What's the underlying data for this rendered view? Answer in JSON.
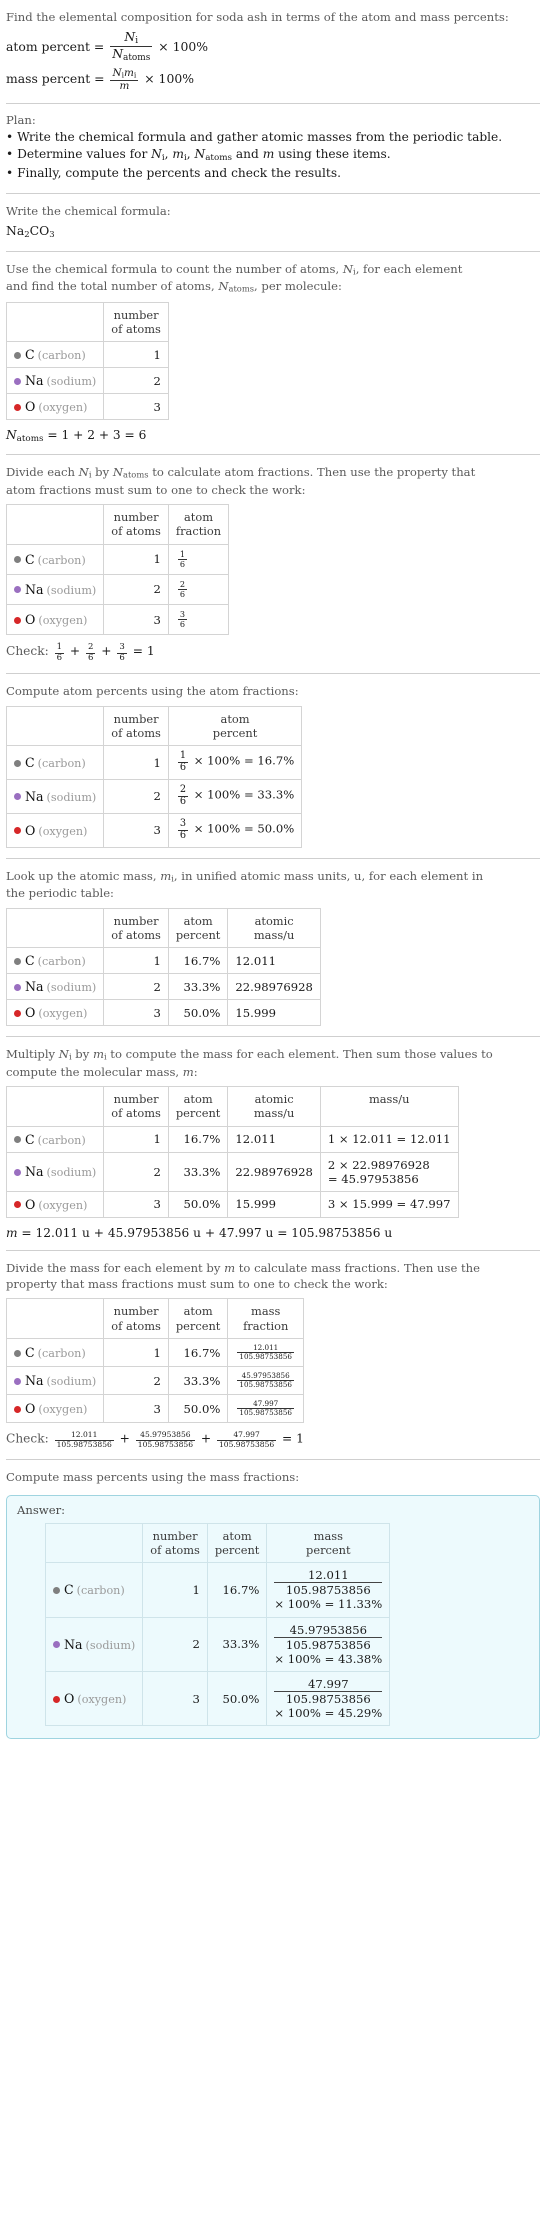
{
  "colors": {
    "carbon": "#7f7f7f",
    "sodium": "#9a6fc0",
    "oxygen": "#d62728",
    "answer_border": "#9fd4e0",
    "answer_bg": "#edfafd"
  },
  "intro": {
    "prompt": "Find the elemental composition for soda ash in terms of the atom and mass percents:",
    "atom_percent_label": "atom percent",
    "atom_percent_num": "N",
    "atom_percent_num_sub": "i",
    "atom_percent_den": "N",
    "atom_percent_den_sub": "atoms",
    "mass_percent_label": "mass percent",
    "mass_percent_num": "N",
    "mass_percent_num_sub": "i",
    "mass_percent_num2": "m",
    "mass_percent_num2_sub": "i",
    "mass_percent_den": "m",
    "times100": "× 100%"
  },
  "plan": {
    "title": "Plan:",
    "items": [
      "• Write the chemical formula and gather atomic masses from the periodic table.",
      "• Determine values for Ni, mi, Natoms and m using these items.",
      "• Finally, compute the percents and check the results."
    ]
  },
  "formula_section": {
    "prompt": "Write the chemical formula:",
    "formula_parts": [
      "Na",
      "2",
      "CO",
      "3"
    ],
    "formula_plain": "Na2CO3"
  },
  "count_section": {
    "prompt_line1": "Use the chemical formula to count the number of atoms, Ni, for each element",
    "prompt_line2": "and find the total number of atoms, Natoms, per molecule:",
    "headers": [
      "",
      "number of atoms"
    ],
    "rows": [
      {
        "symbol": "C",
        "name": "(carbon)",
        "color": "#7f7f7f",
        "count": "1"
      },
      {
        "symbol": "Na",
        "name": "(sodium)",
        "color": "#9a6fc0",
        "count": "2"
      },
      {
        "symbol": "O",
        "name": "(oxygen)",
        "color": "#d62728",
        "count": "3"
      }
    ],
    "total_line": "Natoms = 1 + 2 + 3 = 6",
    "total_value": "6"
  },
  "fraction_section": {
    "prompt_line1": "Divide each Ni by Natoms to calculate atom fractions. Then use the property that",
    "prompt_line2": "atom fractions must sum to one to check the work:",
    "headers": [
      "",
      "number of atoms",
      "atom fraction"
    ],
    "rows": [
      {
        "symbol": "C",
        "name": "(carbon)",
        "color": "#7f7f7f",
        "count": "1",
        "num": "1",
        "den": "6"
      },
      {
        "symbol": "Na",
        "name": "(sodium)",
        "color": "#9a6fc0",
        "count": "2",
        "num": "2",
        "den": "6"
      },
      {
        "symbol": "O",
        "name": "(oxygen)",
        "color": "#d62728",
        "count": "3",
        "num": "3",
        "den": "6"
      }
    ],
    "check_label": "Check:",
    "check_terms": [
      [
        "1",
        "6"
      ],
      [
        "2",
        "6"
      ],
      [
        "3",
        "6"
      ]
    ],
    "check_result": "1"
  },
  "atom_percent_section": {
    "prompt": "Compute atom percents using the atom fractions:",
    "headers": [
      "",
      "number of atoms",
      "atom percent"
    ],
    "rows": [
      {
        "symbol": "C",
        "name": "(carbon)",
        "color": "#7f7f7f",
        "count": "1",
        "num": "1",
        "den": "6",
        "result": "× 100% = 16.7%"
      },
      {
        "symbol": "Na",
        "name": "(sodium)",
        "color": "#9a6fc0",
        "count": "2",
        "num": "2",
        "den": "6",
        "result": "× 100% = 33.3%"
      },
      {
        "symbol": "O",
        "name": "(oxygen)",
        "color": "#d62728",
        "count": "3",
        "num": "3",
        "den": "6",
        "result": "× 100% = 50.0%"
      }
    ]
  },
  "atomic_mass_section": {
    "prompt_line1": "Look up the atomic mass, mi, in unified atomic mass units, u, for each element in",
    "prompt_line2": "the periodic table:",
    "headers": [
      "",
      "number of atoms",
      "atom percent",
      "atomic mass/u"
    ],
    "rows": [
      {
        "symbol": "C",
        "name": "(carbon)",
        "color": "#7f7f7f",
        "count": "1",
        "atom_percent": "16.7%",
        "mass": "12.011"
      },
      {
        "symbol": "Na",
        "name": "(sodium)",
        "color": "#9a6fc0",
        "count": "2",
        "atom_percent": "33.3%",
        "mass": "22.98976928"
      },
      {
        "symbol": "O",
        "name": "(oxygen)",
        "color": "#d62728",
        "count": "3",
        "atom_percent": "50.0%",
        "mass": "15.999"
      }
    ]
  },
  "mass_section": {
    "prompt_line1": "Multiply Ni by mi to compute the mass for each element. Then sum those values to",
    "prompt_line2": "compute the molecular mass, m:",
    "headers": [
      "",
      "number of atoms",
      "atom percent",
      "atomic mass/u",
      "mass/u"
    ],
    "rows": [
      {
        "symbol": "C",
        "name": "(carbon)",
        "color": "#7f7f7f",
        "count": "1",
        "atom_percent": "16.7%",
        "mass": "12.011",
        "product": "1 × 12.011 = 12.011",
        "product2": ""
      },
      {
        "symbol": "Na",
        "name": "(sodium)",
        "color": "#9a6fc0",
        "count": "2",
        "atom_percent": "33.3%",
        "mass": "22.98976928",
        "product": "2 × 22.98976928",
        "product2": "= 45.97953856"
      },
      {
        "symbol": "O",
        "name": "(oxygen)",
        "color": "#d62728",
        "count": "3",
        "atom_percent": "50.0%",
        "mass": "15.999",
        "product": "3 × 15.999 = 47.997",
        "product2": ""
      }
    ],
    "total_line": "m = 12.011 u + 45.97953856 u + 47.997 u = 105.98753856 u"
  },
  "mass_fraction_section": {
    "prompt_line1": "Divide the mass for each element by m to calculate mass fractions. Then use the",
    "prompt_line2": "property that mass fractions must sum to one to check the work:",
    "headers": [
      "",
      "number of atoms",
      "atom percent",
      "mass fraction"
    ],
    "denominator": "105.98753856",
    "rows": [
      {
        "symbol": "C",
        "name": "(carbon)",
        "color": "#7f7f7f",
        "count": "1",
        "atom_percent": "16.7%",
        "num": "12.011"
      },
      {
        "symbol": "Na",
        "name": "(sodium)",
        "color": "#9a6fc0",
        "count": "2",
        "atom_percent": "33.3%",
        "num": "45.97953856"
      },
      {
        "symbol": "O",
        "name": "(oxygen)",
        "color": "#d62728",
        "count": "3",
        "atom_percent": "50.0%",
        "num": "47.997"
      }
    ],
    "check_label": "Check:",
    "check_terms": [
      "12.011",
      "45.97953856",
      "47.997"
    ],
    "check_result": "1"
  },
  "mass_percent_section": {
    "prompt": "Compute mass percents using the mass fractions:",
    "answer_label": "Answer:",
    "headers": [
      "",
      "number of atoms",
      "atom percent",
      "mass percent"
    ],
    "denominator": "105.98753856",
    "rows": [
      {
        "symbol": "C",
        "name": "(carbon)",
        "color": "#7f7f7f",
        "count": "1",
        "atom_percent": "16.7%",
        "num": "12.011",
        "result": "× 100% = 11.33%"
      },
      {
        "symbol": "Na",
        "name": "(sodium)",
        "color": "#9a6fc0",
        "count": "2",
        "atom_percent": "33.3%",
        "num": "45.97953856",
        "result": "× 100% = 43.38%"
      },
      {
        "symbol": "O",
        "name": "(oxygen)",
        "color": "#d62728",
        "count": "3",
        "atom_percent": "50.0%",
        "num": "47.997",
        "result": "× 100% = 45.29%"
      }
    ]
  }
}
